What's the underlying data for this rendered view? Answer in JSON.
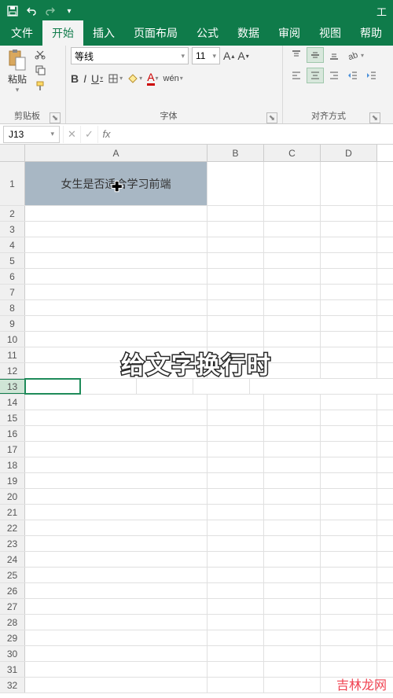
{
  "titlebar": {
    "right_label": "工"
  },
  "tabs": [
    "文件",
    "开始",
    "插入",
    "页面布局",
    "公式",
    "数据",
    "审阅",
    "视图",
    "帮助"
  ],
  "active_tab_index": 1,
  "ribbon": {
    "clipboard": {
      "label": "粘贴",
      "group": "剪贴板"
    },
    "font": {
      "name": "等线",
      "size": "11",
      "group": "字体",
      "buttons": {
        "b": "B",
        "i": "I",
        "u": "U",
        "wen": "wén"
      }
    },
    "align": {
      "group": "对齐方式"
    }
  },
  "namebox": "J13",
  "formula": "",
  "columns": [
    "A",
    "B",
    "C",
    "D"
  ],
  "col_widths": {
    "A": 232,
    "B": 72,
    "C": 72,
    "D": 72
  },
  "a1_text": "女生是否适合学习前端",
  "selected_row": 13,
  "row_count": 32,
  "caption": "给文字换行时",
  "watermark": "吉林龙网"
}
